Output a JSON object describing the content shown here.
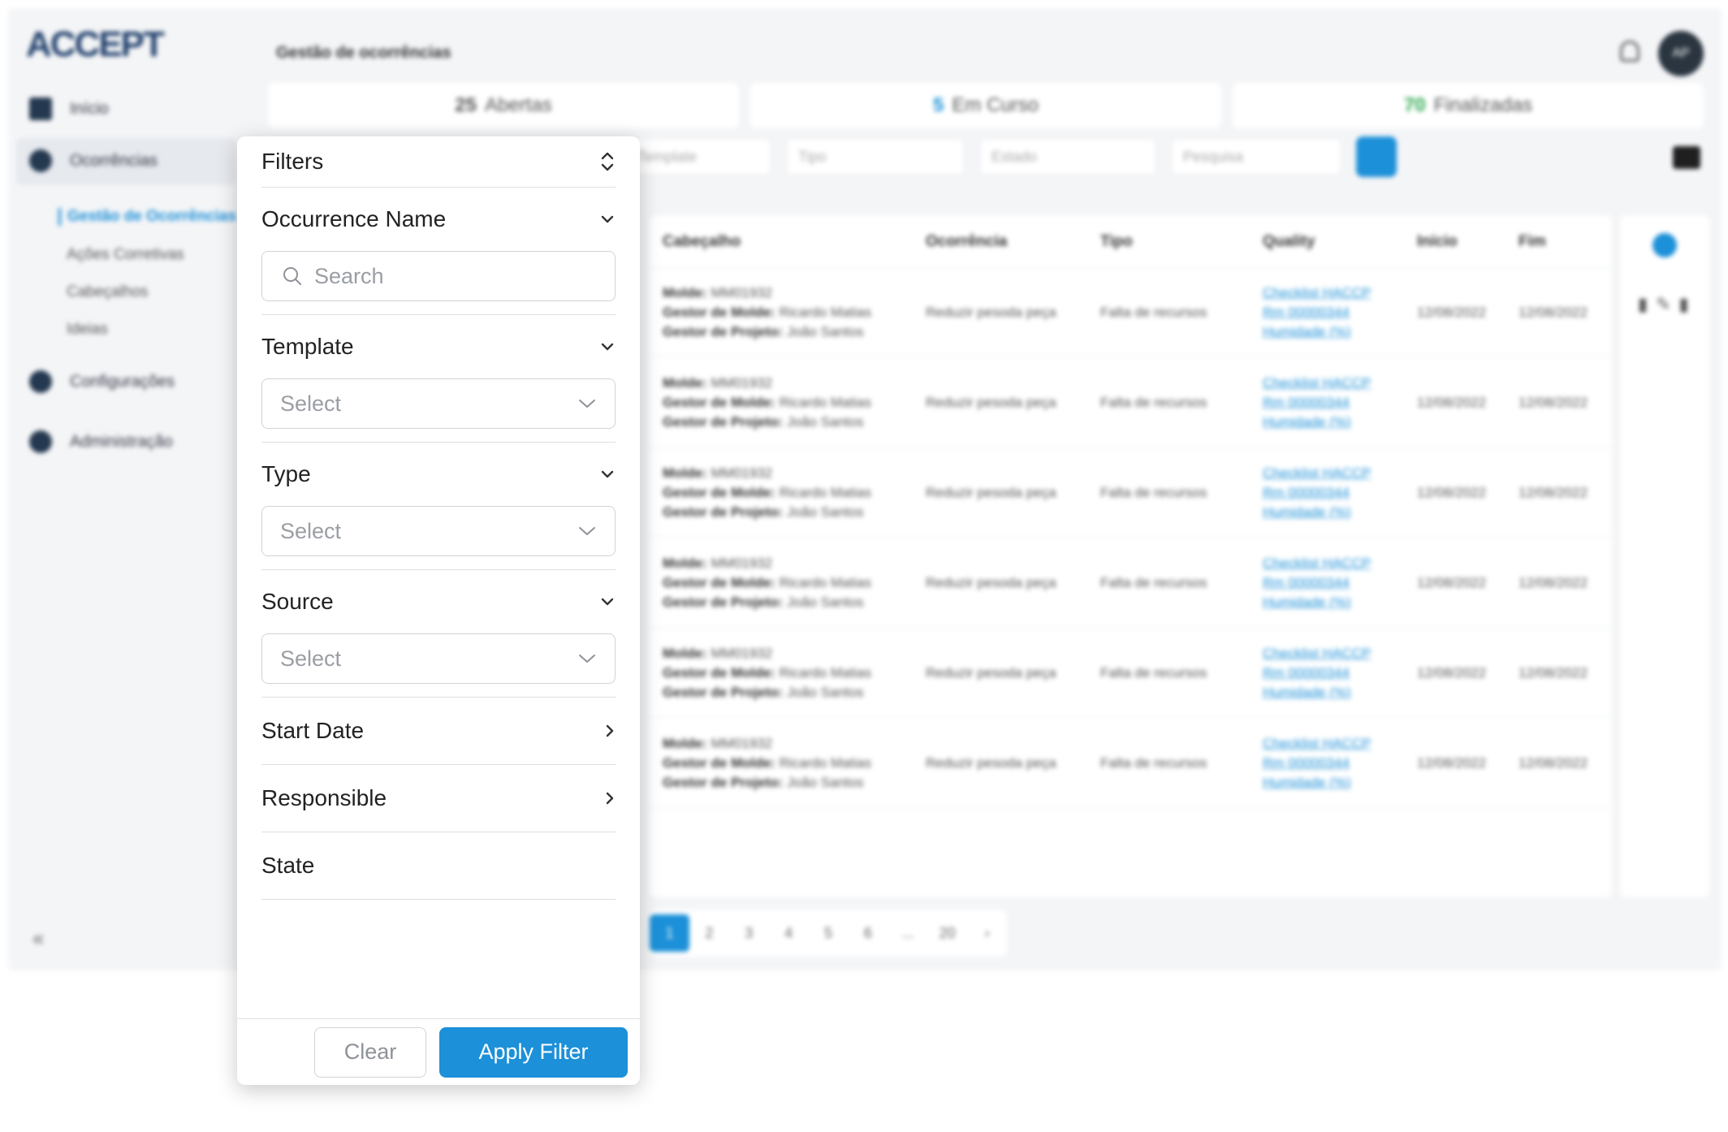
{
  "app": {
    "logo": "ACCEPT",
    "page_title": "Gestão de ocorrências",
    "avatar_initials": "AP",
    "sidebar": {
      "items": [
        {
          "label": "Início"
        },
        {
          "label": "Ocorrências"
        },
        {
          "label": "Configurações"
        },
        {
          "label": "Administração"
        }
      ],
      "subitems": [
        {
          "label": "Gestão de Ocorrências"
        },
        {
          "label": "Ações Corretivas"
        },
        {
          "label": "Cabeçalhos"
        },
        {
          "label": "Ideias"
        }
      ],
      "collapse_label": "«"
    },
    "kpis": [
      {
        "value": "25",
        "label": "Abertas",
        "color": "#555555"
      },
      {
        "value": "5",
        "label": "Em Curso",
        "color": "#1c90d8"
      },
      {
        "value": "70",
        "label": "Finalizadas",
        "color": "#2fa84f"
      }
    ],
    "toolbar": {
      "template_placeholder": "Template",
      "type_placeholder": "Tipo",
      "state_placeholder": "Estado",
      "search_placeholder": "Pesquisa"
    },
    "table": {
      "headers": [
        "Cabeçalho",
        "Ocorrência",
        "Tipo",
        "Quality",
        "Início",
        "Fim"
      ],
      "rows": [
        {
          "molde": "MM01932",
          "gestor_molde": "Ricardo Matias",
          "gestor_projeto": "João Santos",
          "ocorrencia": "Reduzir pesoda peça",
          "tipo": "Falta de recursos",
          "q1": "Checklist HACCP",
          "q2": "Rm 00000344",
          "q3": "Humidade (%)",
          "inicio": "12/08/2022",
          "fim": "12/08/2022"
        },
        {
          "molde": "MM01932",
          "gestor_molde": "Ricardo Matias",
          "gestor_projeto": "João Santos",
          "ocorrencia": "Reduzir pesoda peça",
          "tipo": "Falta de recursos",
          "q1": "Checklist HACCP",
          "q2": "Rm 00000344",
          "q3": "Humidade (%)",
          "inicio": "12/08/2022",
          "fim": "12/08/2022"
        },
        {
          "molde": "MM01932",
          "gestor_molde": "Ricardo Matias",
          "gestor_projeto": "João Santos",
          "ocorrencia": "Reduzir pesoda peça",
          "tipo": "Falta de recursos",
          "q1": "Checklist HACCP",
          "q2": "Rm 00000344",
          "q3": "Humidade (%)",
          "inicio": "12/08/2022",
          "fim": "12/08/2022"
        },
        {
          "molde": "MM01932",
          "gestor_molde": "Ricardo Matias",
          "gestor_projeto": "João Santos",
          "ocorrencia": "Reduzir pesoda peça",
          "tipo": "Falta de recursos",
          "q1": "Checklist HACCP",
          "q2": "Rm 00000344",
          "q3": "Humidade (%)",
          "inicio": "12/08/2022",
          "fim": "12/08/2022"
        },
        {
          "molde": "MM01932",
          "gestor_molde": "Ricardo Matias",
          "gestor_projeto": "João Santos",
          "ocorrencia": "Reduzir pesoda peça",
          "tipo": "Falta de recursos",
          "q1": "Checklist HACCP",
          "q2": "Rm 00000344",
          "q3": "Humidade (%)",
          "inicio": "12/08/2022",
          "fim": "12/08/2022"
        },
        {
          "molde": "MM01932",
          "gestor_molde": "Ricardo Matias",
          "gestor_projeto": "João Santos",
          "ocorrencia": "Reduzir pesoda peça",
          "tipo": "Falta de recursos",
          "q1": "Checklist HACCP",
          "q2": "Rm 00000344",
          "q3": "Humidade (%)",
          "inicio": "12/08/2022",
          "fim": "12/08/2022"
        }
      ],
      "row_labels": {
        "molde": "Molde:",
        "gestor_molde": "Gestor de Molde:",
        "gestor_projeto": "Gestor de Projeto:"
      }
    },
    "pagination": [
      "1",
      "2",
      "3",
      "4",
      "5",
      "6",
      "...",
      "20",
      "›"
    ]
  },
  "filters": {
    "title": "Filters",
    "occurrence_name": {
      "label": "Occurrence Name",
      "placeholder": "Search"
    },
    "template": {
      "label": "Template",
      "placeholder": "Select"
    },
    "type": {
      "label": "Type",
      "placeholder": "Select"
    },
    "source": {
      "label": "Source",
      "placeholder": "Select"
    },
    "start_date": {
      "label": "Start Date"
    },
    "responsible": {
      "label": "Responsible"
    },
    "state": {
      "label": "State"
    },
    "clear_label": "Clear",
    "apply_label": "Apply Filter"
  },
  "colors": {
    "accent": "#1c90d8",
    "sidebar_dark": "#24384f"
  }
}
